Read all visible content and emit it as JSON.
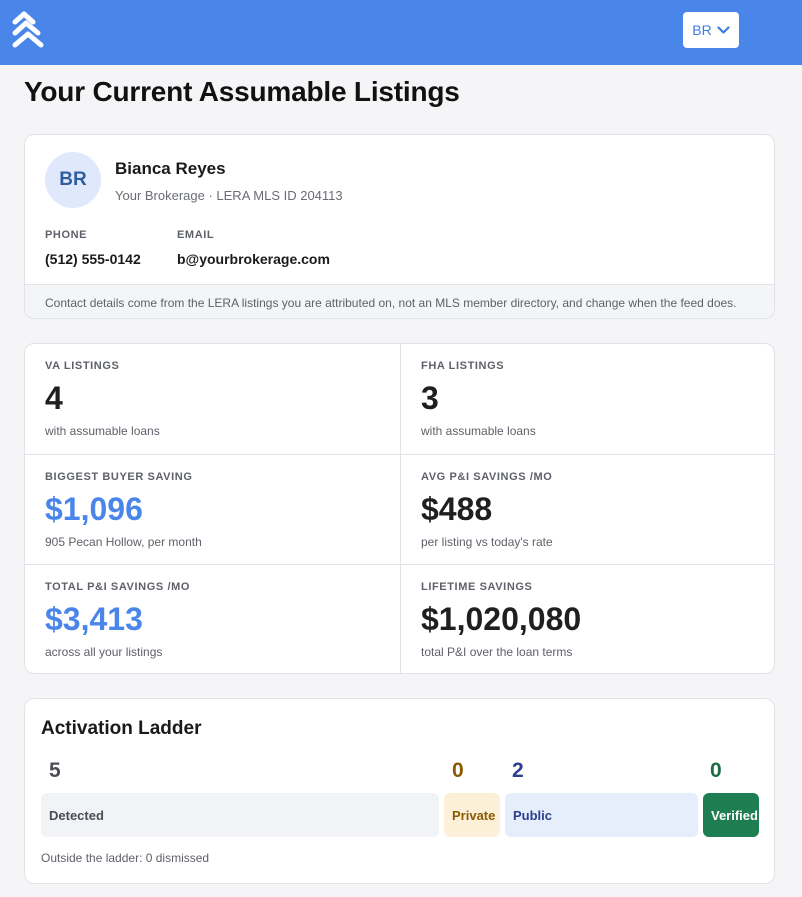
{
  "app": {
    "logo_icon": "chevrons-up-logo",
    "user_menu": {
      "initials": "BR",
      "icon": "chevron-down-icon"
    },
    "colors": {
      "header": "#4a86ea",
      "accent": "#4a86ea"
    }
  },
  "page": {
    "title": "Your Current Assumable Listings"
  },
  "profile": {
    "initials": "BR",
    "name": "Bianca Reyes",
    "subtitle": "Your Brokerage · LERA MLS ID 204113",
    "phone_label": "PHONE",
    "phone": "(512) 555-0142",
    "email_label": "EMAIL",
    "email": "b@yourbrokerage.com",
    "footnote": "Contact details come from the LERA listings you are attributed on, not an MLS member directory, and change when the feed does."
  },
  "stats": [
    {
      "label": "VA LISTINGS",
      "value": "4",
      "note": "with assumable loans"
    },
    {
      "label": "FHA LISTINGS",
      "value": "3",
      "note": "with assumable loans"
    },
    {
      "label": "BIGGEST BUYER SAVING",
      "value": "$1,096",
      "note": "905 Pecan Hollow, per month"
    },
    {
      "label": "AVG P&I SAVINGS /MO",
      "value": "$488",
      "note": "per listing vs today's rate"
    },
    {
      "label": "TOTAL P&I SAVINGS /MO",
      "value": "$3,413",
      "note": "across all your listings"
    },
    {
      "label": "LIFETIME SAVINGS",
      "value": "$1,020,080",
      "note": "total P&I over the loan terms"
    }
  ],
  "ladder": {
    "title": "Activation Ladder",
    "stages": [
      {
        "label": "Detected",
        "count": "5",
        "color": "#4a4d55",
        "bg": "#f1f3f6"
      },
      {
        "label": "Private",
        "count": "0",
        "color": "#8a5a00",
        "bg": "#fdf0d9"
      },
      {
        "label": "Public",
        "count": "2",
        "color": "#2a3f8f",
        "bg": "#e6eefc"
      },
      {
        "label": "Verified",
        "count": "0",
        "color": "#1c6b47",
        "bg": "#1f7d52"
      }
    ],
    "footnote": "Outside the ladder: 0 dismissed"
  }
}
